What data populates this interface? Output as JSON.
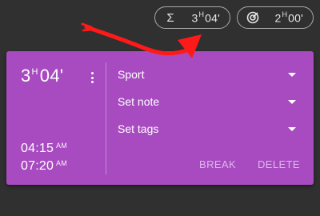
{
  "summary": {
    "total": {
      "icon": "sigma-icon",
      "hours": "3",
      "hours_unit": "H",
      "minutes": "04'"
    },
    "goal": {
      "icon": "target-icon",
      "hours": "2",
      "hours_unit": "H",
      "minutes": "00'"
    }
  },
  "entry": {
    "duration": {
      "hours": "3",
      "hours_unit": "H",
      "minutes": "04'"
    },
    "start": {
      "time": "04:15",
      "ampm": "AM"
    },
    "end": {
      "time": "07:20",
      "ampm": "AM"
    },
    "activity": "Sport",
    "note_placeholder": "Set note",
    "tags_placeholder": "Set tags",
    "break_label": "BREAK",
    "delete_label": "DELETE"
  },
  "colors": {
    "background": "#303030",
    "card": "#a84bc1",
    "annotation_arrow": "#ff1a1a"
  }
}
